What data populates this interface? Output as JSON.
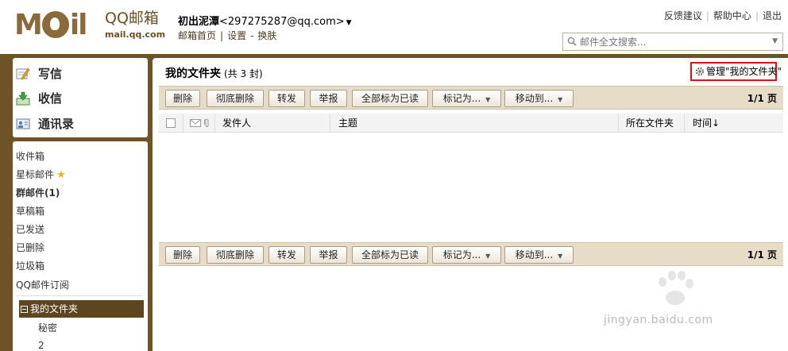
{
  "header": {
    "logo_cn": "QQ邮箱",
    "logo_url": "mail.qq.com",
    "user_name": "初出泥潭",
    "user_email": "<297275287@qq.com>",
    "links": [
      "邮箱首页",
      "设置",
      "换肤"
    ],
    "top_links": [
      "反馈建议",
      "帮助中心",
      "退出"
    ],
    "search_placeholder": "邮件全文搜索..."
  },
  "sidebar": {
    "compose": "写信",
    "inbox_big": "收信",
    "contacts": "通讯录",
    "folders": [
      "收件箱",
      "星标邮件",
      "群邮件(1)",
      "草稿箱",
      "已发送",
      "已删除",
      "垃圾箱",
      "QQ邮件订阅"
    ],
    "my_folders_label": "我的文件夹",
    "my_folders": [
      "秘密",
      "2"
    ]
  },
  "main": {
    "title": "我的文件夹",
    "count": "(共 3 封)",
    "manage_label": "管理\"我的文件夹\"",
    "toolbar": {
      "delete": "删除",
      "perm_delete": "彻底删除",
      "forward": "转发",
      "report": "举报",
      "mark_all_read": "全部标为已读",
      "mark_as": "标记为...",
      "move_to": "移动到..."
    },
    "pager": "1/1 页",
    "columns": {
      "sender": "发件人",
      "subject": "主题",
      "folder": "所在文件夹",
      "time": "时间↓"
    }
  },
  "watermark": "jingyan.baidu.com",
  "colors": {
    "frame_brown": "#6e5326",
    "toolbar_beige": "#e6dcc8",
    "highlight_red": "#e0101a"
  }
}
